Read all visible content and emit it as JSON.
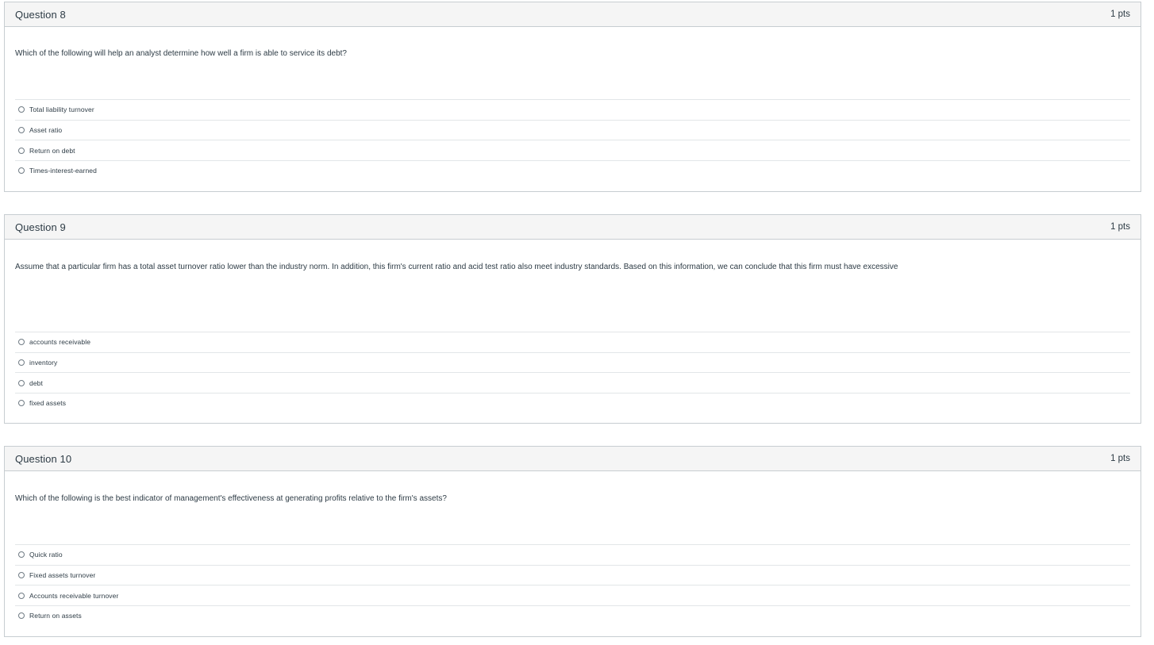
{
  "questions": [
    {
      "name": "Question 8",
      "points": "1 pts",
      "text": "Which of the following will help an analyst determine how well a firm is able to service its debt?",
      "answers": [
        "Total liability turnover",
        "Asset ratio",
        "Return on debt",
        "Times-interest-earned"
      ]
    },
    {
      "name": "Question 9",
      "points": "1 pts",
      "text": "Assume that a particular firm has a total asset turnover ratio lower than the industry norm. In addition, this firm's current ratio and acid test ratio also meet industry standards. Based on this information, we can conclude that this firm must have excessive",
      "answers": [
        "accounts receivable",
        "inventory",
        "debt",
        "fixed assets"
      ]
    },
    {
      "name": "Question 10",
      "points": "1 pts",
      "text": "Which of the following is the best indicator of management's effectiveness at generating profits relative to the firm's assets?",
      "answers": [
        "Quick ratio",
        "Fixed assets turnover",
        "Accounts receivable turnover",
        "Return on assets"
      ]
    }
  ]
}
